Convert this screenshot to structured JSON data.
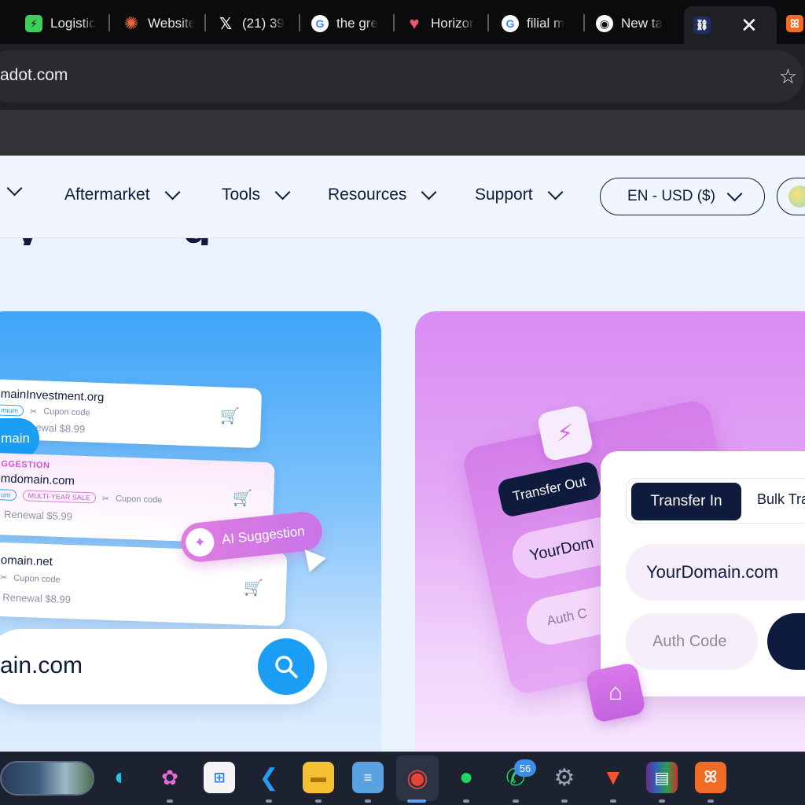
{
  "browser": {
    "tabs": [
      {
        "title": "Logistic",
        "icon": "green-app-icon",
        "color": "#3ecf5a"
      },
      {
        "title": "Website",
        "icon": "sunburst-icon",
        "color": "#e8643c"
      },
      {
        "title": "(21) 39",
        "icon": "x-logo-icon",
        "color": "#ffffff"
      },
      {
        "title": "the gre",
        "icon": "google-icon",
        "color": "#4285f4"
      },
      {
        "title": "Horizor",
        "icon": "heart-icon",
        "color": "#f1576d"
      },
      {
        "title": "filial m",
        "icon": "google-icon",
        "color": "#4285f4"
      },
      {
        "title": "New ta",
        "icon": "chrome-icon",
        "color": "#ffffff"
      }
    ],
    "active_tab_close": "✕",
    "address": "adot.com"
  },
  "nav": {
    "items": [
      "",
      "Aftermarket",
      "Tools",
      "Resources",
      "Support"
    ],
    "lang": "EN - USD ($)"
  },
  "blue_card": {
    "results": [
      {
        "domain": "mainInvestment.org",
        "tag": "mium",
        "coupon": "Cupon code",
        "renewal": "ewal $8.99"
      },
      {
        "label": "GGESTION",
        "domain": "mdomain.com",
        "tag": "um",
        "tag2": "MULTI-YEAR SALE",
        "coupon": "Cupon code",
        "renewal": "Renewal $5.99"
      },
      {
        "domain": "omain.net",
        "coupon": "Cupon code",
        "renewal": "Renewal $8.99"
      }
    ],
    "main_pill": "main",
    "ai_suggestion": "AI Suggestion",
    "search_value": "ain.com"
  },
  "purple_card": {
    "back_transfer_out": "Transfer Out",
    "back_domain": "YourDom",
    "back_auth": "Auth C",
    "tab_transfer_in": "Transfer In",
    "tab_bulk": "Bulk Tra",
    "domain_value": "YourDomain.com",
    "auth_placeholder": "Auth Code"
  },
  "taskbar": {
    "whatsapp_badge": "56",
    "icons": [
      "edge-icon",
      "copilot-icon",
      "store-icon",
      "vscode-icon",
      "file-explorer-icon",
      "notepad-icon",
      "chrome-icon",
      "spotify-icon",
      "whatsapp-icon",
      "settings-icon",
      "brave-icon",
      "winrar-icon",
      "xampp-icon"
    ]
  },
  "colors": {
    "navy": "#0e1b3d",
    "blue_accent": "#1a9df4",
    "purple_accent": "#c874e9"
  }
}
